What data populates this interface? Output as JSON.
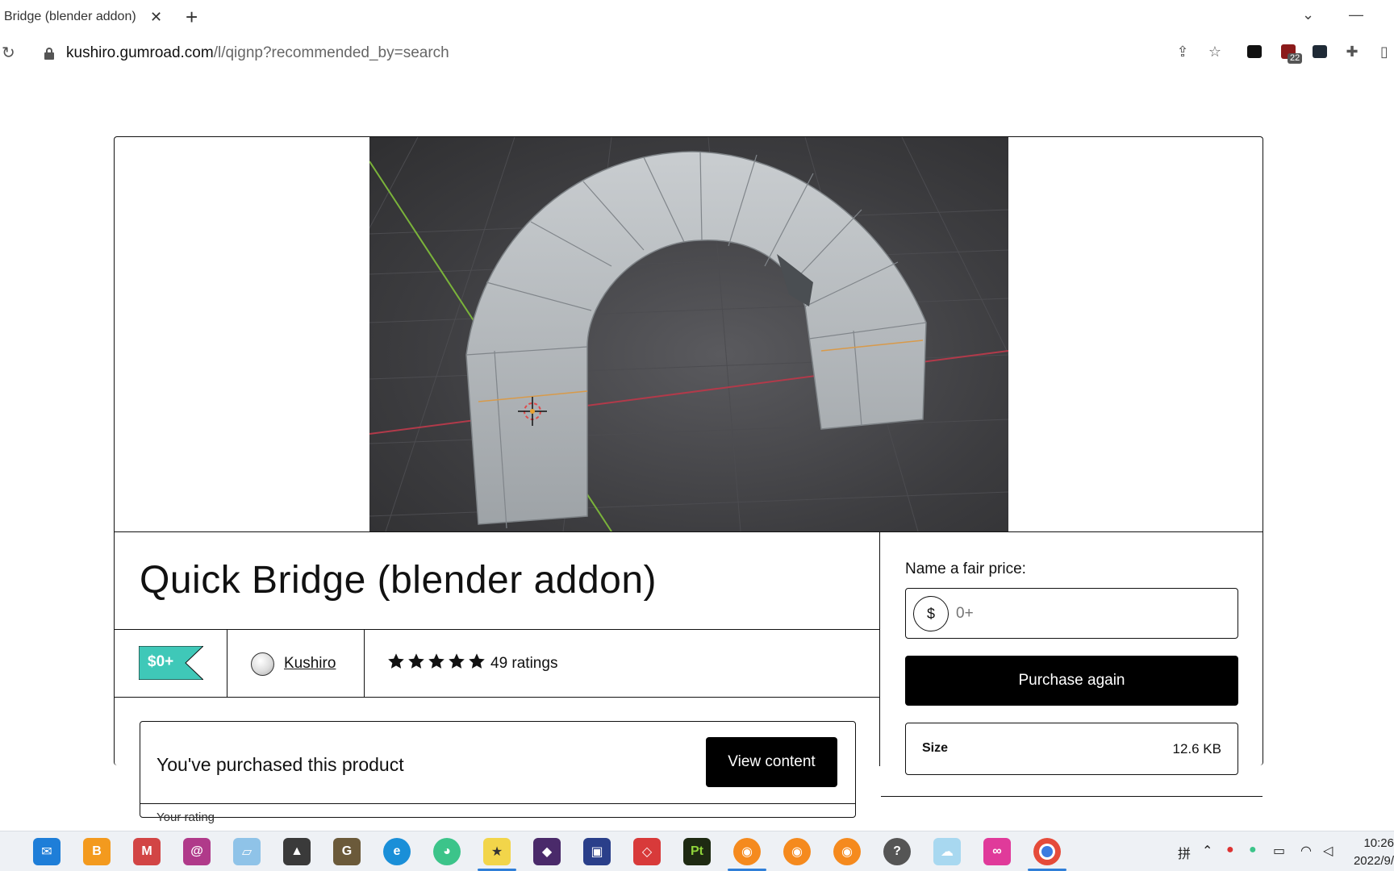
{
  "browser": {
    "tab_title": "Bridge (blender addon)",
    "url_host": "kushiro.gumroad.com",
    "url_path": "/l/qignp?recommended_by=search",
    "extension_badge": "22"
  },
  "product": {
    "title": "Quick Bridge (blender addon)",
    "price_badge": "$0+",
    "author": "Kushiro",
    "rating_count": "49 ratings",
    "stars": 5,
    "purchased_text": "You've purchased this product",
    "view_content_label": "View content",
    "your_rating_label": "Your rating"
  },
  "purchase_panel": {
    "fair_price_label": "Name a fair price:",
    "currency_symbol": "$",
    "price_placeholder": "0+",
    "purchase_button": "Purchase again",
    "size_label": "Size",
    "size_value": "12.6 KB"
  },
  "taskbar": {
    "ime_label": "拼",
    "time": "10:26",
    "date": "2022/9/"
  },
  "colors": {
    "price_tag": "#3fc8b8",
    "button_bg": "#000000"
  }
}
